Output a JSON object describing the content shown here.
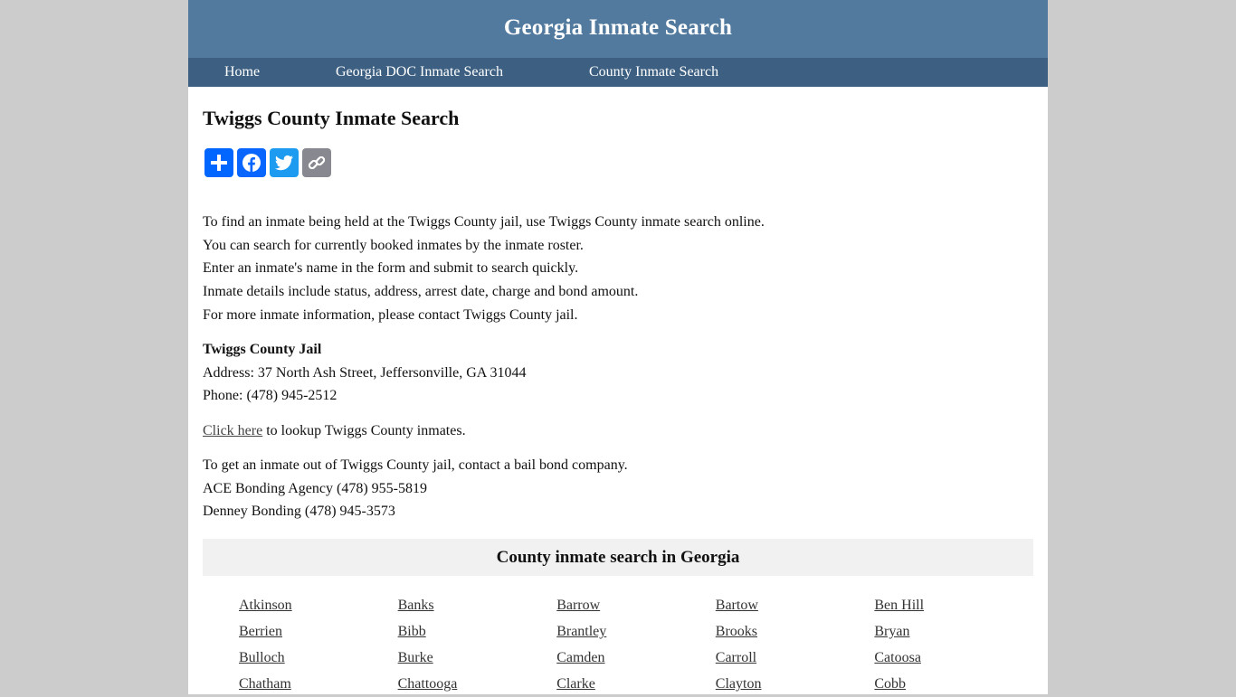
{
  "header": {
    "site_title": "Georgia Inmate Search"
  },
  "nav": {
    "items": [
      {
        "label": "Home"
      },
      {
        "label": "Georgia DOC Inmate Search"
      },
      {
        "label": "County Inmate Search"
      }
    ]
  },
  "main": {
    "title": "Twiggs County Inmate Search",
    "share_buttons": [
      {
        "icon": "plus-icon",
        "label": "Share",
        "color": "#0166ff"
      },
      {
        "icon": "facebook-icon",
        "label": "Facebook",
        "color": "#0866ff"
      },
      {
        "icon": "twitter-icon",
        "label": "Twitter",
        "color": "#1d9bf0"
      },
      {
        "icon": "link-icon",
        "label": "Copy Link",
        "color": "#888990"
      }
    ],
    "intro_lines": [
      "To find an inmate being held at the Twiggs County jail, use Twiggs County inmate search online.",
      "You can search for currently booked inmates by the inmate roster.",
      "Enter an inmate's name in the form and submit to search quickly.",
      "Inmate details include status, address, arrest date, charge and bond amount.",
      "For more inmate information, please contact Twiggs County jail."
    ],
    "jail": {
      "name": "Twiggs County Jail",
      "address": "Address: 37 North Ash Street, Jeffersonville, GA 31044",
      "phone": "Phone: (478) 945-2512"
    },
    "lookup": {
      "link_text": "Click here",
      "suffix": " to lookup Twiggs County inmates."
    },
    "bail": {
      "intro": "To get an inmate out of Twiggs County jail, contact a bail bond company.",
      "companies": [
        "ACE Bonding Agency (478) 955-5819",
        "Denney Bonding (478) 945-3573"
      ]
    }
  },
  "county_section": {
    "title": "County inmate search in Georgia",
    "counties": [
      "Atkinson",
      "Banks",
      "Barrow",
      "Bartow",
      "Ben Hill",
      "Berrien",
      "Bibb",
      "Brantley",
      "Brooks",
      "Bryan",
      "Bulloch",
      "Burke",
      "Camden",
      "Carroll",
      "Catoosa",
      "Chatham",
      "Chattooga",
      "Clarke",
      "Clayton",
      "Cobb"
    ]
  }
}
